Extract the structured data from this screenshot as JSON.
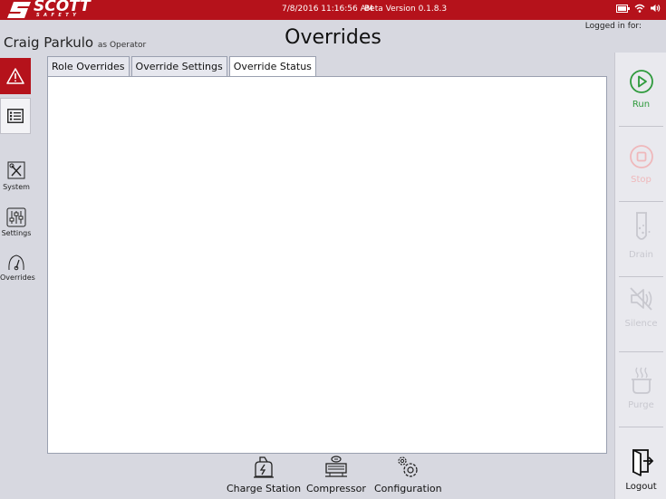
{
  "titlebar": {
    "brand": "SCOTT",
    "brand_sub": "SAFETY",
    "datetime": "7/8/2016 11:16:56 AM",
    "version": "Beta Version 0.1.8.3",
    "icons": [
      "battery-icon",
      "wifi-icon",
      "speaker-icon"
    ]
  },
  "header": {
    "user_name": "Craig Parkulo",
    "user_role": "as Operator",
    "page_title": "Overrides",
    "logged_in_label": "Logged in for:"
  },
  "left_nav": {
    "alert_icon": "warning-icon",
    "list_icon": "list-icon",
    "items": [
      {
        "label": "System",
        "icon": "system-tools-icon"
      },
      {
        "label": "Settings",
        "icon": "sliders-icon"
      },
      {
        "label": "Overrides",
        "icon": "overrides-gauge-icon"
      }
    ]
  },
  "tabs": [
    {
      "label": "Role Overrides",
      "active": false
    },
    {
      "label": "Override Settings",
      "active": false
    },
    {
      "label": "Override Status",
      "active": true
    }
  ],
  "right_actions": [
    {
      "label": "Run",
      "icon": "play-circle-icon",
      "enabled": true
    },
    {
      "label": "Stop",
      "icon": "stop-circle-icon",
      "enabled": false
    },
    {
      "label": "Drain",
      "icon": "test-tube-icon",
      "enabled": false
    },
    {
      "label": "Silence",
      "icon": "mute-speaker-icon",
      "enabled": false
    },
    {
      "label": "Purge",
      "icon": "steaming-pot-icon",
      "enabled": false
    },
    {
      "label": "Logout",
      "icon": "logout-icon",
      "enabled": true
    }
  ],
  "bottom_nav": [
    {
      "label": "Charge Station",
      "icon": "charge-station-icon"
    },
    {
      "label": "Compressor",
      "icon": "compressor-icon"
    },
    {
      "label": "Configuration",
      "icon": "gears-icon"
    }
  ],
  "colors": {
    "brand_red": "#b5121b",
    "run_green": "#2e9a3c",
    "background": "#d7d8e0"
  }
}
